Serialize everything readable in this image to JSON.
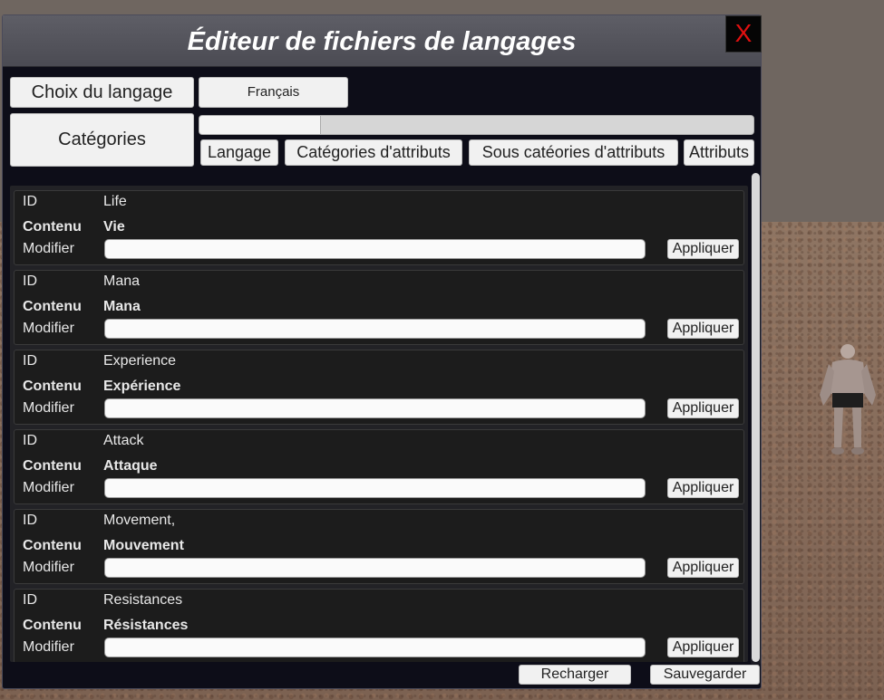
{
  "window": {
    "title": "Éditeur de fichiers de langages",
    "close_label": "X"
  },
  "controls": {
    "language_choice_label": "Choix du langage",
    "language_value": "Français",
    "categories_label": "Catégories",
    "progress_fraction": 0.22
  },
  "tabs": [
    {
      "label": "Langage"
    },
    {
      "label": "Catégories d'attributs"
    },
    {
      "label": "Sous catéories d'attributs"
    },
    {
      "label": "Attributs"
    }
  ],
  "entry_labels": {
    "id": "ID",
    "content": "Contenu",
    "modify": "Modifier",
    "apply": "Appliquer"
  },
  "entries": [
    {
      "id": "Life",
      "content": "Vie"
    },
    {
      "id": "Mana",
      "content": "Mana"
    },
    {
      "id": "Experience",
      "content": "Expérience"
    },
    {
      "id": "Attack",
      "content": "Attaque"
    },
    {
      "id": "Movement,",
      "content": "Mouvement"
    },
    {
      "id": "Resistances",
      "content": "Résistances"
    }
  ],
  "footer": {
    "reload_label": "Recharger",
    "save_label": "Sauvegarder"
  },
  "colors": {
    "window_bg": "#0d0d18",
    "titlebar": "#55555d",
    "close_x": "#e01010"
  }
}
